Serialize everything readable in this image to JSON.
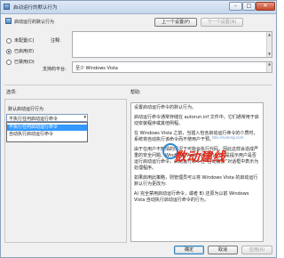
{
  "window": {
    "title": "启动运行的默认行为",
    "buttons": {
      "min": "–",
      "max": "□",
      "close": "✕"
    }
  },
  "header": {
    "setting_name": "启动运行的默认行为",
    "prev_button": "上一个设置(P)",
    "next_button": "下一个设置(N)"
  },
  "state": {
    "options": [
      {
        "label": "未配置(C)",
        "checked": false
      },
      {
        "label": "已启用(E)",
        "checked": true
      },
      {
        "label": "已禁用(D)",
        "checked": false
      }
    ]
  },
  "comment": {
    "label": "注释:"
  },
  "supported": {
    "label": "支持的平台:",
    "value": "至少 Windows Vista"
  },
  "sections": {
    "options_label": "选项:",
    "help_label": "帮助:"
  },
  "options_panel": {
    "field_label": "默认启动运行行为",
    "selected": "不执行任何启动运行命令",
    "items": [
      "不执行任何启动运行命令",
      "自动执行启动运行命令"
    ]
  },
  "help": {
    "paragraphs": [
      "设置启动运行命令的默认行为。",
      "启动运行命令通常存储在 autorun.inf 文件中。它们通常用于启动安装程序或其他例程。",
      "在 Windows Vista 之前，当插入包含启动运行命令的介质时，系统将自动执行该命令而不使用户干预。",
      "由于在用户不知情的情况下可能会执行代码，因此这样会造成严重的安全问题。Windows Vista 中的默认行为是提示用户是否运行启动运行命令。启动运行命令在“自动播放”对话框中表示为处理程序。",
      "如果启用此策略，则管理员可以将 Windows Vista 的启动运行默认行为更改为:",
      "A) 完全禁用启动运行命令，或者 B) 还原为以前 Windows Vista 自动执行启动运行命令的行为。"
    ]
  },
  "footer": {
    "ok": "确定",
    "cancel": "取消",
    "apply": "应用(A)"
  },
  "watermark": {
    "text": "数动建线",
    "url": "bbs.shudong.com"
  }
}
